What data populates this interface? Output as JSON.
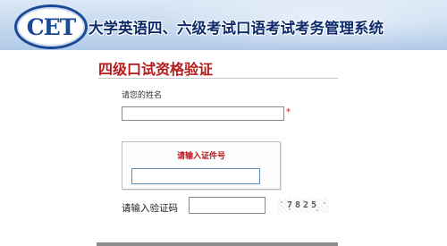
{
  "header": {
    "logo_text": "CET",
    "title": "大学英语四、六级考试口语考试考务管理系统",
    "colors": {
      "banner": "#c3d7ee",
      "title_text": "#0e2c6c",
      "logo_ring": "#1a4a96"
    }
  },
  "page": {
    "title": "四级口试资格验证",
    "title_color": "#b51b1b"
  },
  "form": {
    "name": {
      "label": "请您的姓名",
      "value": "",
      "required_mark": "*"
    },
    "id_number": {
      "label": "请输入证件号",
      "value": ""
    },
    "captcha": {
      "label": "请输入验证码",
      "value": "",
      "image_text": "7825"
    }
  }
}
